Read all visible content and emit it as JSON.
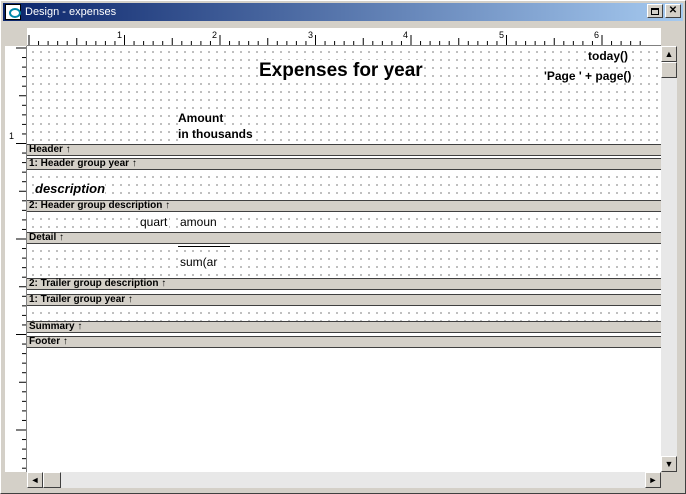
{
  "window": {
    "title": "Design - expenses",
    "minimize_icon": "minimize-icon",
    "maximize_icon": "maximize-icon",
    "close_icon": "close-icon"
  },
  "ruler": {
    "inch_labels": [
      "1",
      "2",
      "3",
      "4",
      "5",
      "6"
    ],
    "left_label": "1"
  },
  "report": {
    "title": "Expenses for  year",
    "today": "today()",
    "page": "'Page ' + page()",
    "amount_line1": "Amount",
    "amount_line2": "in thousands",
    "description": "description",
    "quarter": "quart",
    "amount": "amoun",
    "sum": "sum(ar"
  },
  "bands": [
    {
      "label": "Header ↑"
    },
    {
      "label": "1: Header group year ↑"
    },
    {
      "label": "2: Header group description ↑"
    },
    {
      "label": "Detail ↑"
    },
    {
      "label": "2: Trailer group description ↑"
    },
    {
      "label": "1: Trailer group year ↑"
    },
    {
      "label": "Summary ↑"
    },
    {
      "label": "Footer ↑"
    }
  ],
  "scroll": {
    "up": "▲",
    "down": "▼",
    "left": "◄",
    "right": "►"
  }
}
